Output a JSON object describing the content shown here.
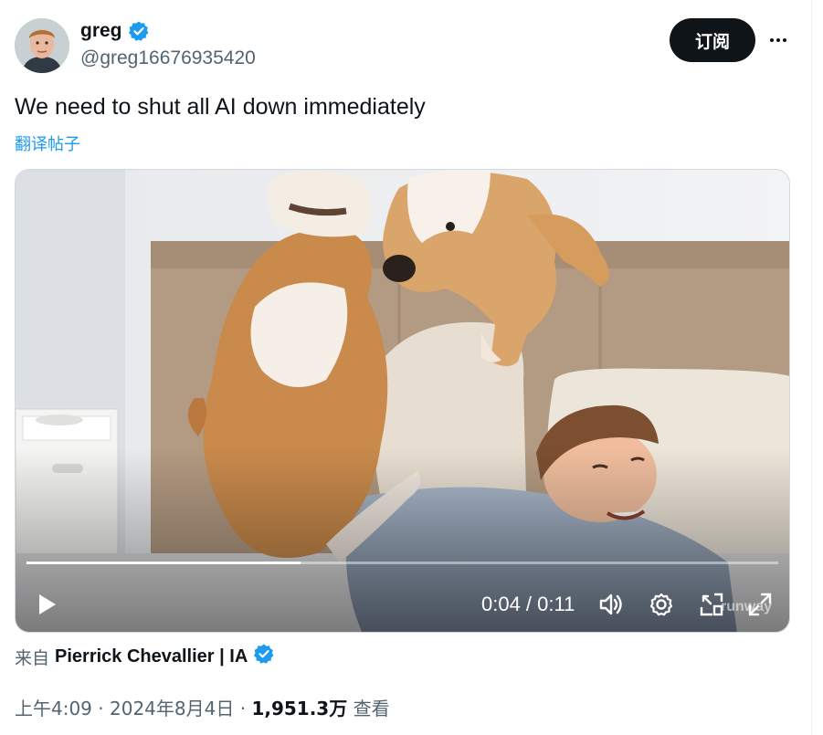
{
  "user": {
    "display_name": "greg",
    "handle": "@greg16676935420",
    "verified": true,
    "avatar_icon": "profile-photo"
  },
  "actions": {
    "subscribe_label": "订阅",
    "more_icon": "more-horizontal-icon"
  },
  "tweet": {
    "text": "We need to shut all AI down immediately",
    "translate_label": "翻译帖子"
  },
  "video": {
    "time": "0:04 / 0:11",
    "progress": 0.364,
    "watermark": "runway",
    "controls": [
      "play-icon",
      "volume-icon",
      "settings-icon",
      "pip-icon",
      "fullscreen-icon"
    ]
  },
  "source": {
    "prefix": "来自",
    "name": "Pierrick Chevallier | IA",
    "verified": true
  },
  "meta": {
    "time": "上午4:09",
    "separator": " · ",
    "date": "2024年8月4日",
    "views_count": "1,951.3万",
    "views_label": "查看"
  },
  "colors": {
    "accent": "#1d9bf0",
    "text_primary": "#0f1419",
    "text_secondary": "#536471",
    "button_dark": "#0f1419"
  }
}
